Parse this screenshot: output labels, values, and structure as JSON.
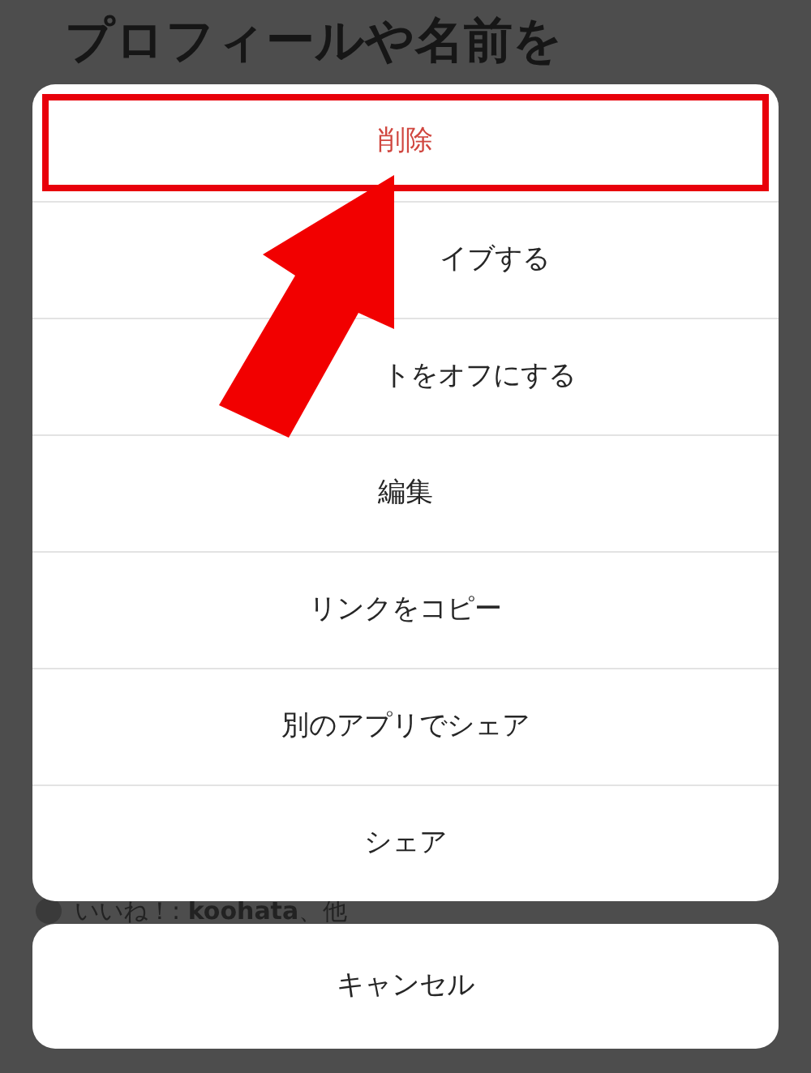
{
  "background": {
    "title": "プロフィールや名前を",
    "likes": "いいね！: **koohata**、他"
  },
  "menu": {
    "items": [
      {
        "label": "削除",
        "kind": "destructive",
        "highlighted": true
      },
      {
        "label": "イブする",
        "kind": "obscured",
        "highlighted": false
      },
      {
        "label": "トをオフにする",
        "kind": "obscured",
        "highlighted": false
      },
      {
        "label": "編集",
        "kind": "normal",
        "highlighted": false
      },
      {
        "label": "リンクをコピー",
        "kind": "normal",
        "highlighted": false
      },
      {
        "label": "別のアプリでシェア",
        "kind": "normal",
        "highlighted": false
      },
      {
        "label": "シェア",
        "kind": "normal",
        "highlighted": false
      }
    ]
  },
  "cancel": "キャンセル"
}
